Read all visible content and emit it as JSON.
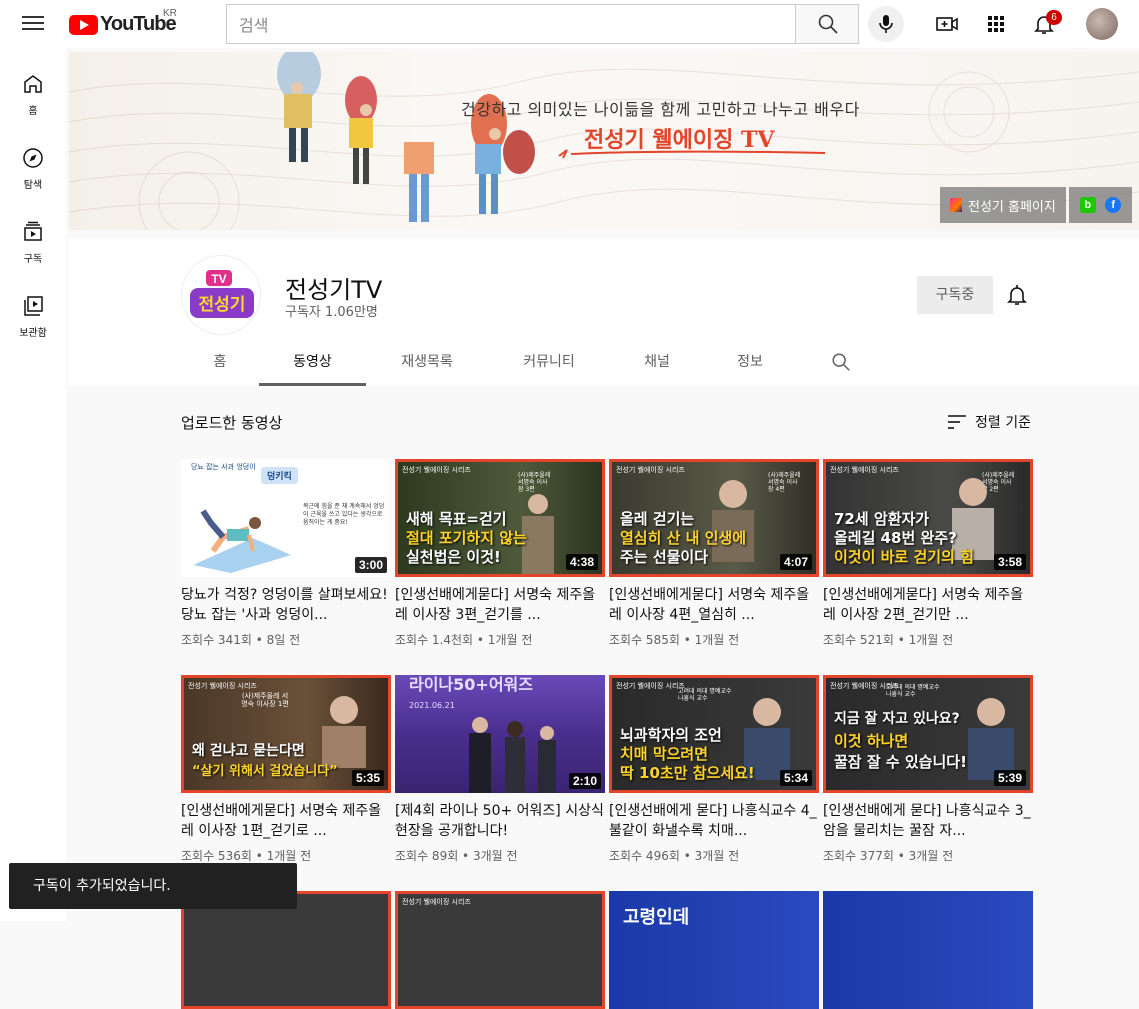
{
  "header": {
    "logo_text": "YouTube",
    "region": "KR",
    "search_placeholder": "검색",
    "notification_count": "6"
  },
  "sidebar": {
    "items": [
      {
        "label": "홈",
        "icon": "home-icon"
      },
      {
        "label": "탐색",
        "icon": "compass-icon"
      },
      {
        "label": "구독",
        "icon": "subscriptions-icon"
      },
      {
        "label": "보관함",
        "icon": "library-icon"
      }
    ]
  },
  "banner": {
    "tagline": "건강하고 의미있는 나이듦을 함께 고민하고 나누고 배우다",
    "title": "전성기 웰에이징 TV",
    "homepage_link": "전성기 홈페이지"
  },
  "channel": {
    "name": "전성기TV",
    "subscribers": "구독자 1.06만명",
    "subscribe_label": "구독중",
    "avatar_text": {
      "tv": "TV",
      "name": "전성기"
    }
  },
  "tabs": [
    {
      "label": "홈",
      "active": false
    },
    {
      "label": "동영상",
      "active": true
    },
    {
      "label": "재생목록",
      "active": false
    },
    {
      "label": "커뮤니티",
      "active": false
    },
    {
      "label": "채널",
      "active": false
    },
    {
      "label": "정보",
      "active": false
    }
  ],
  "section": {
    "title": "업로드한 동영상",
    "sort_label": "정렬 기준"
  },
  "videos": [
    {
      "title": "당뇨가 걱정? 엉덩이를 살펴보세요! 당뇨 잡는 '사과 엉덩이...",
      "meta": "조회수 341회 • 8일 전",
      "duration": "3:00",
      "thumb_top": "당뇨 잡는 사과 엉덩이",
      "thumb_tag": "덩키킥",
      "thumb_desc": "복근에 힘을 준 채 계속해서 엉덩이 근육을 쓰고 있다는 생각으로 움직이는 게 중요!"
    },
    {
      "title": "[인생선배에게묻다] 서명숙 제주올레 이사장 3편_걷기를 ...",
      "meta": "조회수 1.4천회 • 1개월 전",
      "duration": "4:38",
      "thumb_line1": "새해 목표=걷기",
      "thumb_line2": "절대 포기하지 않는",
      "thumb_line3": "실천법은 이것!",
      "thumb_badge": "(사)제주올레 서명숙 이사장 3편"
    },
    {
      "title": "[인생선배에게묻다] 서명숙 제주올레 이사장 4편_열심히 ...",
      "meta": "조회수 585회 • 1개월 전",
      "duration": "4:07",
      "thumb_line1": "올레 걷기는",
      "thumb_line2": "열심히 산 내 인생에",
      "thumb_line3": "주는 선물이다",
      "thumb_badge": "(사)제주올레 서명숙 이사장 4편"
    },
    {
      "title": "[인생선배에게묻다] 서명숙 제주올레 이사장 2편_걷기만 ...",
      "meta": "조회수 521회 • 1개월 전",
      "duration": "3:58",
      "thumb_line1": "72세 암환자가",
      "thumb_line2": "올레길 48번 완주?",
      "thumb_line3": "이것이 바로 걷기의 힘",
      "thumb_badge": "(사)제주올레 서명숙 이사장 2편"
    },
    {
      "title": "[인생선배에게묻다] 서명숙 제주올레 이사장 1편_걷기로 ...",
      "meta": "조회수 536회 • 1개월 전",
      "duration": "5:35",
      "thumb_line1": "왜 걷냐고 묻는다면",
      "thumb_line2": "“살기 위해서 걸었습니다”",
      "thumb_badge": "(사)제주올레 서명숙 이사장 1편"
    },
    {
      "title": "[제4회 라이나 50+ 어워즈] 시상식 현장을 공개합니다!",
      "meta": "조회수 89회 • 3개월 전",
      "duration": "2:10",
      "thumb_line1": "라이나50+어워즈",
      "thumb_date": "2021.06.21"
    },
    {
      "title": "[인생선배에게 묻다] 나흥식교수 4_ 불같이 화낼수록 치매...",
      "meta": "조회수 496회 • 3개월 전",
      "duration": "5:34",
      "thumb_line1": "뇌과학자의 조언",
      "thumb_line2": "치매 막으려면",
      "thumb_line3": "딱 10초만 참으세요!",
      "thumb_badge": "고려대 의대 명예교수 나흥식 교수"
    },
    {
      "title": "[인생선배에게 묻다] 나흥식교수 3_ 암을 물리치는 꿀잠 자...",
      "meta": "조회수 377회 • 3개월 전",
      "duration": "5:39",
      "thumb_line1": "지금 잘 자고 있나요?",
      "thumb_line2": "이것 하나면",
      "thumb_line3": "꿀잠 잘 수 있습니다!",
      "thumb_badge": "고려대 의대 명예교수 나흥식 교수"
    }
  ],
  "partial_row": {
    "third_thumb_text": "고령인데"
  },
  "thumb_brand": "전성기 웰에이징 시리즈",
  "toast": "구독이 추가되었습니다.",
  "colors": {
    "accent_red": "#ff0000",
    "brand_orange": "#e2452a",
    "badge_red": "#cc0000"
  }
}
